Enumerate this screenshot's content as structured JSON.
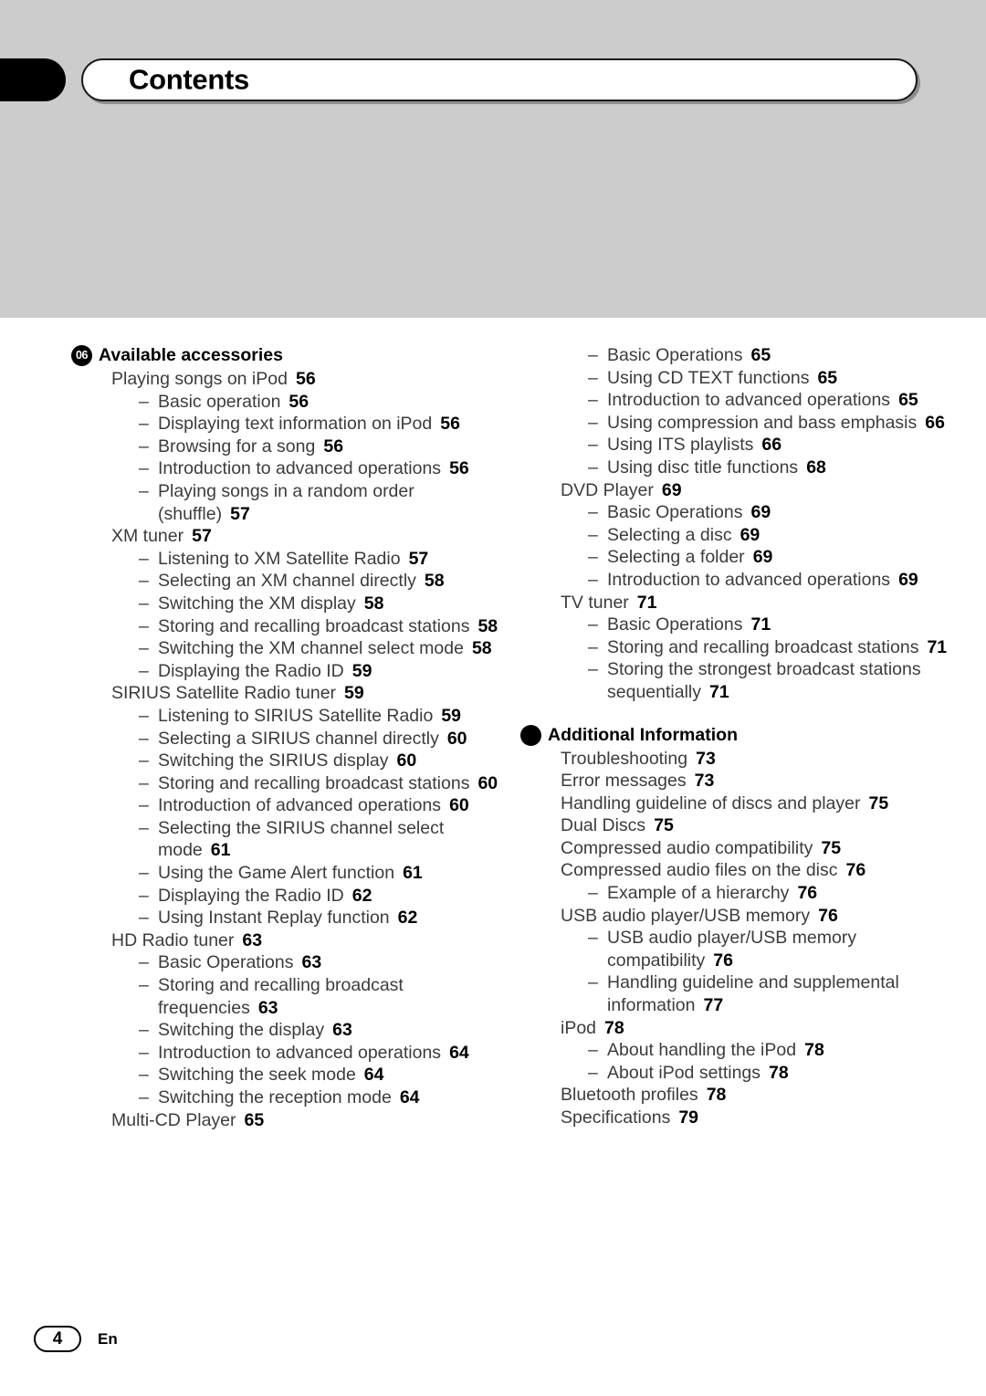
{
  "header": {
    "title": "Contents",
    "tab_icon": "black-chapter-tab"
  },
  "footer": {
    "page_number": "4",
    "language_code": "En"
  },
  "columns": {
    "left": [
      {
        "badge": "06",
        "heading": "Available accessories",
        "entries": [
          {
            "level": 1,
            "text": "Playing songs on iPod",
            "page": "56"
          },
          {
            "level": 2,
            "text": "Basic operation",
            "page": "56"
          },
          {
            "level": 2,
            "text": "Displaying text information on iPod",
            "page": "56"
          },
          {
            "level": 2,
            "text": "Browsing for a song",
            "page": "56"
          },
          {
            "level": 2,
            "text": "Introduction to advanced operations",
            "page": "56"
          },
          {
            "level": 2,
            "text": "Playing songs in a random order (shuffle)",
            "page": "57"
          },
          {
            "level": 1,
            "text": "XM tuner",
            "page": "57"
          },
          {
            "level": 2,
            "text": "Listening to XM Satellite Radio",
            "page": "57"
          },
          {
            "level": 2,
            "text": "Selecting an XM channel directly",
            "page": "58"
          },
          {
            "level": 2,
            "text": "Switching the XM display",
            "page": "58"
          },
          {
            "level": 2,
            "text": "Storing and recalling broadcast stations",
            "page": "58"
          },
          {
            "level": 2,
            "text": "Switching the XM channel select mode",
            "page": "58"
          },
          {
            "level": 2,
            "text": "Displaying the Radio ID",
            "page": "59"
          },
          {
            "level": 1,
            "text": "SIRIUS Satellite Radio tuner",
            "page": "59"
          },
          {
            "level": 2,
            "text": "Listening to SIRIUS Satellite Radio",
            "page": "59"
          },
          {
            "level": 2,
            "text": "Selecting a SIRIUS channel directly",
            "page": "60"
          },
          {
            "level": 2,
            "text": "Switching the SIRIUS display",
            "page": "60"
          },
          {
            "level": 2,
            "text": "Storing and recalling broadcast stations",
            "page": "60"
          },
          {
            "level": 2,
            "text": "Introduction of advanced operations",
            "page": "60"
          },
          {
            "level": 2,
            "text": "Selecting the SIRIUS channel select mode",
            "page": "61"
          },
          {
            "level": 2,
            "text": "Using the Game Alert function",
            "page": "61"
          },
          {
            "level": 2,
            "text": "Displaying the Radio ID",
            "page": "62"
          },
          {
            "level": 2,
            "text": "Using Instant Replay function",
            "page": "62"
          },
          {
            "level": 1,
            "text": "HD Radio tuner",
            "page": "63"
          },
          {
            "level": 2,
            "text": "Basic Operations",
            "page": "63"
          },
          {
            "level": 2,
            "text": "Storing and recalling broadcast frequencies",
            "page": "63"
          },
          {
            "level": 2,
            "text": "Switching the display",
            "page": "63"
          },
          {
            "level": 2,
            "text": "Introduction to advanced operations",
            "page": "64"
          },
          {
            "level": 2,
            "text": "Switching the seek mode",
            "page": "64"
          },
          {
            "level": 2,
            "text": "Switching the reception mode",
            "page": "64"
          },
          {
            "level": 1,
            "text": "Multi-CD Player",
            "page": "65"
          }
        ]
      }
    ],
    "right": [
      {
        "badge": null,
        "heading": null,
        "entries": [
          {
            "level": 2,
            "text": "Basic Operations",
            "page": "65"
          },
          {
            "level": 2,
            "text": "Using CD TEXT functions",
            "page": "65"
          },
          {
            "level": 2,
            "text": "Introduction to advanced operations",
            "page": "65"
          },
          {
            "level": 2,
            "text": "Using compression and bass emphasis",
            "page": "66"
          },
          {
            "level": 2,
            "text": "Using ITS playlists",
            "page": "66"
          },
          {
            "level": 2,
            "text": "Using disc title functions",
            "page": "68"
          },
          {
            "level": 1,
            "text": "DVD Player",
            "page": "69"
          },
          {
            "level": 2,
            "text": "Basic Operations",
            "page": "69"
          },
          {
            "level": 2,
            "text": "Selecting a disc",
            "page": "69"
          },
          {
            "level": 2,
            "text": "Selecting a folder",
            "page": "69"
          },
          {
            "level": 2,
            "text": "Introduction to advanced operations",
            "page": "69"
          },
          {
            "level": 1,
            "text": "TV tuner",
            "page": "71"
          },
          {
            "level": 2,
            "text": "Basic Operations",
            "page": "71"
          },
          {
            "level": 2,
            "text": "Storing and recalling broadcast stations",
            "page": "71"
          },
          {
            "level": 2,
            "text": "Storing the strongest broadcast stations sequentially",
            "page": "71"
          }
        ]
      },
      {
        "badge": "",
        "heading": "Additional Information",
        "entries": [
          {
            "level": 1,
            "text": "Troubleshooting",
            "page": "73"
          },
          {
            "level": 1,
            "text": "Error messages",
            "page": "73"
          },
          {
            "level": 1,
            "text": "Handling guideline of discs and player",
            "page": "75"
          },
          {
            "level": 1,
            "text": "Dual Discs",
            "page": "75"
          },
          {
            "level": 1,
            "text": "Compressed audio compatibility",
            "page": "75"
          },
          {
            "level": 1,
            "text": "Compressed audio files on the disc",
            "page": "76"
          },
          {
            "level": 2,
            "text": "Example of a hierarchy",
            "page": "76"
          },
          {
            "level": 1,
            "text": "USB audio player/USB memory",
            "page": "76"
          },
          {
            "level": 2,
            "text": "USB audio player/USB memory compatibility",
            "page": "76"
          },
          {
            "level": 2,
            "text": "Handling guideline and supplemental information",
            "page": "77"
          },
          {
            "level": 1,
            "text": "iPod",
            "page": "78"
          },
          {
            "level": 2,
            "text": "About handling the iPod",
            "page": "78"
          },
          {
            "level": 2,
            "text": "About iPod settings",
            "page": "78"
          },
          {
            "level": 1,
            "text": "Bluetooth profiles",
            "page": "78"
          },
          {
            "level": 1,
            "text": "Specifications",
            "page": "79"
          }
        ]
      }
    ]
  },
  "entry_dash": "–",
  "colors": {
    "header_band": "#cccccc",
    "accent_black": "#000000",
    "entry_text": "#3c3c3c"
  }
}
